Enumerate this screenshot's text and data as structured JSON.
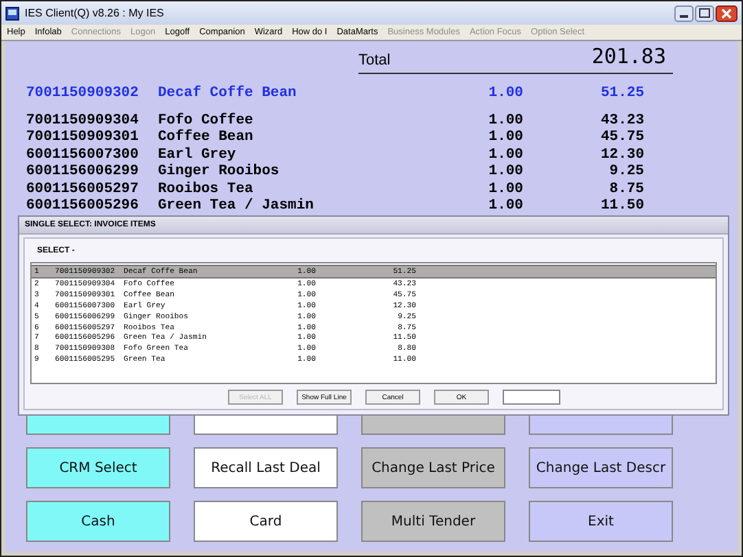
{
  "window": {
    "title": "IES Client(Q) v8.26 : My IES"
  },
  "menu": [
    {
      "label": "Help",
      "disabled": false
    },
    {
      "label": "Infolab",
      "disabled": false
    },
    {
      "label": "Connections",
      "disabled": true
    },
    {
      "label": "Logon",
      "disabled": true
    },
    {
      "label": "Logoff",
      "disabled": false
    },
    {
      "label": "Companion",
      "disabled": false
    },
    {
      "label": "Wizard",
      "disabled": false
    },
    {
      "label": "How do I",
      "disabled": false
    },
    {
      "label": "DataMarts",
      "disabled": false
    },
    {
      "label": "Business Modules",
      "disabled": true
    },
    {
      "label": "Action Focus",
      "disabled": true
    },
    {
      "label": "Option Select",
      "disabled": true
    }
  ],
  "total": {
    "label": "Total",
    "value": "201.83"
  },
  "current_item": {
    "code": "7001150909302",
    "description": "Decaf Coffe Bean",
    "qty": "1.00",
    "amount": "51.25"
  },
  "items": [
    {
      "code": "7001150909304",
      "description": "Fofo Coffee",
      "qty": "1.00",
      "amount": "43.23"
    },
    {
      "code": "7001150909301",
      "description": "Coffee Bean",
      "qty": "1.00",
      "amount": "45.75"
    },
    {
      "code": "6001156007300",
      "description": "Earl Grey",
      "qty": "1.00",
      "amount": "12.30"
    },
    {
      "code": "6001156006299",
      "description": "Ginger Rooibos",
      "qty": "1.00",
      "amount": "9.25"
    },
    {
      "code": "6001156005297",
      "description": "Rooibos Tea",
      "qty": "1.00",
      "amount": "8.75"
    },
    {
      "code": "6001156005296",
      "description": "Green Tea / Jasmin",
      "qty": "1.00",
      "amount": "11.50"
    }
  ],
  "buttons": [
    {
      "color": "#80f8f8"
    },
    {
      "color": "#ffffff"
    },
    {
      "color": "#c0c0c0"
    },
    {
      "color": "#c8c8f8"
    },
    {
      "label": "CRM Select",
      "color": "#80f8f8"
    },
    {
      "label": "Recall Last Deal",
      "color": "#ffffff"
    },
    {
      "label": "Change Last Price",
      "color": "#c0c0c0"
    },
    {
      "label": "Change Last Descr",
      "color": "#c8c8f8"
    },
    {
      "label": "Cash",
      "color": "#80f8f8"
    },
    {
      "label": "Card",
      "color": "#ffffff"
    },
    {
      "label": "Multi Tender",
      "color": "#c0c0c0"
    },
    {
      "label": "Exit",
      "color": "#c8c8f8"
    }
  ],
  "dialog": {
    "title": "SINGLE SELECT: INVOICE ITEMS",
    "heading": "SELECT -",
    "rows": [
      {
        "number": "1",
        "code": "7001150909302",
        "description": "Decaf Coffe Bean",
        "qty": "1.00",
        "amount": "51.25",
        "selected": true
      },
      {
        "number": "2",
        "code": "7001150909304",
        "description": "Fofo Coffee",
        "qty": "1.00",
        "amount": "43.23",
        "selected": false
      },
      {
        "number": "3",
        "code": "7001150909301",
        "description": "Coffee Bean",
        "qty": "1.00",
        "amount": "45.75",
        "selected": false
      },
      {
        "number": "4",
        "code": "6001156007300",
        "description": "Earl Grey",
        "qty": "1.00",
        "amount": "12.30",
        "selected": false
      },
      {
        "number": "5",
        "code": "6001156006299",
        "description": "Ginger Rooibos",
        "qty": "1.00",
        "amount": "9.25",
        "selected": false
      },
      {
        "number": "6",
        "code": "6001156005297",
        "description": "Rooibos Tea",
        "qty": "1.00",
        "amount": "8.75",
        "selected": false
      },
      {
        "number": "7",
        "code": "6001156005296",
        "description": "Green Tea / Jasmin",
        "qty": "1.00",
        "amount": "11.50",
        "selected": false
      },
      {
        "number": "8",
        "code": "7001150909308",
        "description": "Fofo Green Tea",
        "qty": "1.00",
        "amount": "8.80",
        "selected": false
      },
      {
        "number": "9",
        "code": "6001156005295",
        "description": "Green Tea",
        "qty": "1.00",
        "amount": "11.00",
        "selected": false
      }
    ],
    "buttons": [
      {
        "label": "Select ALL",
        "disabled": true
      },
      {
        "label": "Show Full Line",
        "disabled": false
      },
      {
        "label": "Cancel",
        "disabled": false
      },
      {
        "label": "OK",
        "disabled": false
      }
    ]
  }
}
